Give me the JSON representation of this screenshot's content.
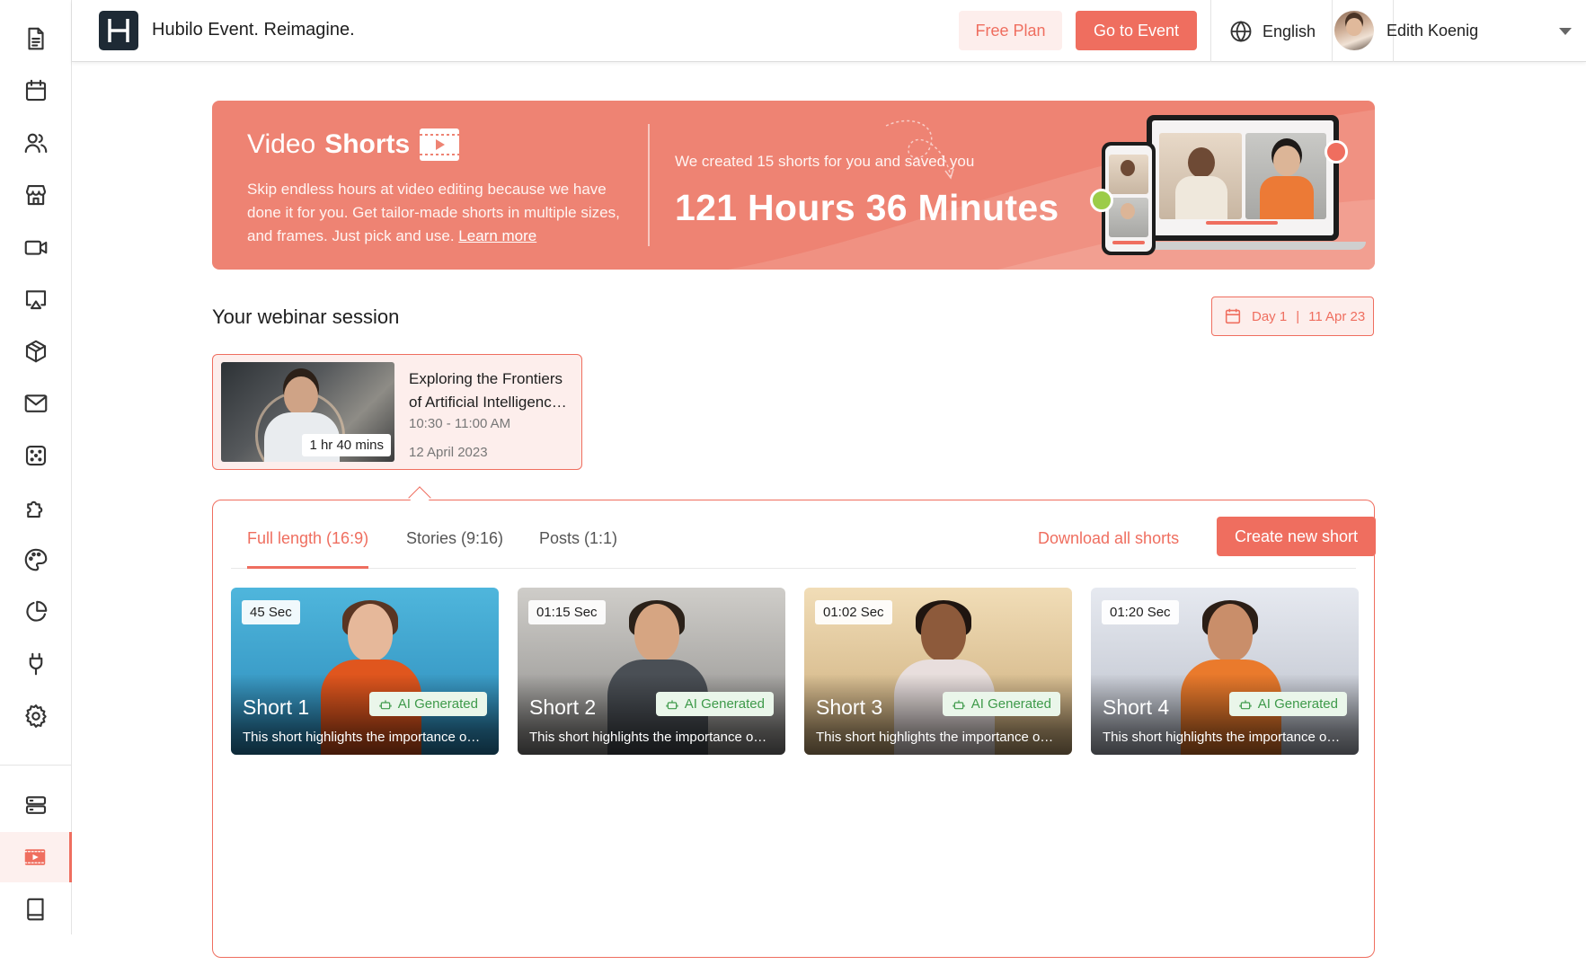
{
  "header": {
    "brand": "Hubilo Event. Reimagine.",
    "free_plan": "Free Plan",
    "go_to_event": "Go to Event",
    "language": "English",
    "user_name": "Edith Koenig"
  },
  "sidebar": {
    "items": [
      {
        "icon": "document-icon"
      },
      {
        "icon": "calendar-icon"
      },
      {
        "icon": "people-icon"
      },
      {
        "icon": "store-icon"
      },
      {
        "icon": "video-camera-icon"
      },
      {
        "icon": "screen-cast-icon"
      },
      {
        "icon": "package-icon"
      },
      {
        "icon": "mail-icon"
      },
      {
        "icon": "dice-icon"
      },
      {
        "icon": "puzzle-icon"
      },
      {
        "icon": "palette-icon"
      },
      {
        "icon": "pie-chart-icon"
      },
      {
        "icon": "plug-icon"
      },
      {
        "icon": "gear-icon"
      },
      {
        "icon": "server-icon"
      },
      {
        "icon": "video-shorts-icon"
      },
      {
        "icon": "book-icon"
      }
    ],
    "active": "video-shorts-icon"
  },
  "banner": {
    "title_light": "Video",
    "title_bold": "Shorts",
    "description": "Skip endless hours at video editing because we have done it for you. Get tailor-made shorts in multiple sizes, and frames. Just pick and use.",
    "learn_more": "Learn more",
    "saved_text": "We created 15 shorts for you and saved you",
    "saved_time": "121 Hours 36 Minutes"
  },
  "session": {
    "section_title": "Your webinar session",
    "day_label": "Day 1",
    "day_date": "11 Apr 23",
    "card": {
      "title": "Exploring the Frontiers of Artificial Intelligenc…",
      "time": "10:30 - 11:00 AM",
      "date": "12 April 2023",
      "duration": "1 hr 40 mins"
    }
  },
  "shorts": {
    "tabs": [
      {
        "label": "Full length (16:9)",
        "active": true
      },
      {
        "label": "Stories (9:16)",
        "active": false
      },
      {
        "label": "Posts (1:1)",
        "active": false
      }
    ],
    "download_all": "Download all shorts",
    "create_new": "Create new short",
    "badge_label": "AI Generated",
    "items": [
      {
        "title": "Short 1",
        "duration": "45 Sec",
        "description": "This short highlights the importance o…",
        "colors": {
          "bg_top": "#4fb6dc",
          "bg_bottom": "#2a88b8",
          "body": "#e0561e",
          "hair": "#5a3522",
          "skin": "#e6b89a"
        }
      },
      {
        "title": "Short 2",
        "duration": "01:15 Sec",
        "description": "This short highlights the importance o…",
        "colors": {
          "bg_top": "#cfcdc9",
          "bg_bottom": "#8b8a88",
          "body": "#4a4f55",
          "hair": "#2b2119",
          "skin": "#d6a582"
        }
      },
      {
        "title": "Short 3",
        "duration": "01:02 Sec",
        "description": "This short highlights the importance o…",
        "colors": {
          "bg_top": "#f1ddb7",
          "bg_bottom": "#c9a977",
          "body": "#e8dedd",
          "hair": "#1f1510",
          "skin": "#8d5a3b"
        }
      },
      {
        "title": "Short 4",
        "duration": "01:20 Sec",
        "description": "This short highlights the importance o…",
        "colors": {
          "bg_top": "#e6e9f0",
          "bg_bottom": "#b8bdc8",
          "body": "#ea7a2c",
          "hair": "#2b1e16",
          "skin": "#c98e6a"
        }
      }
    ]
  }
}
